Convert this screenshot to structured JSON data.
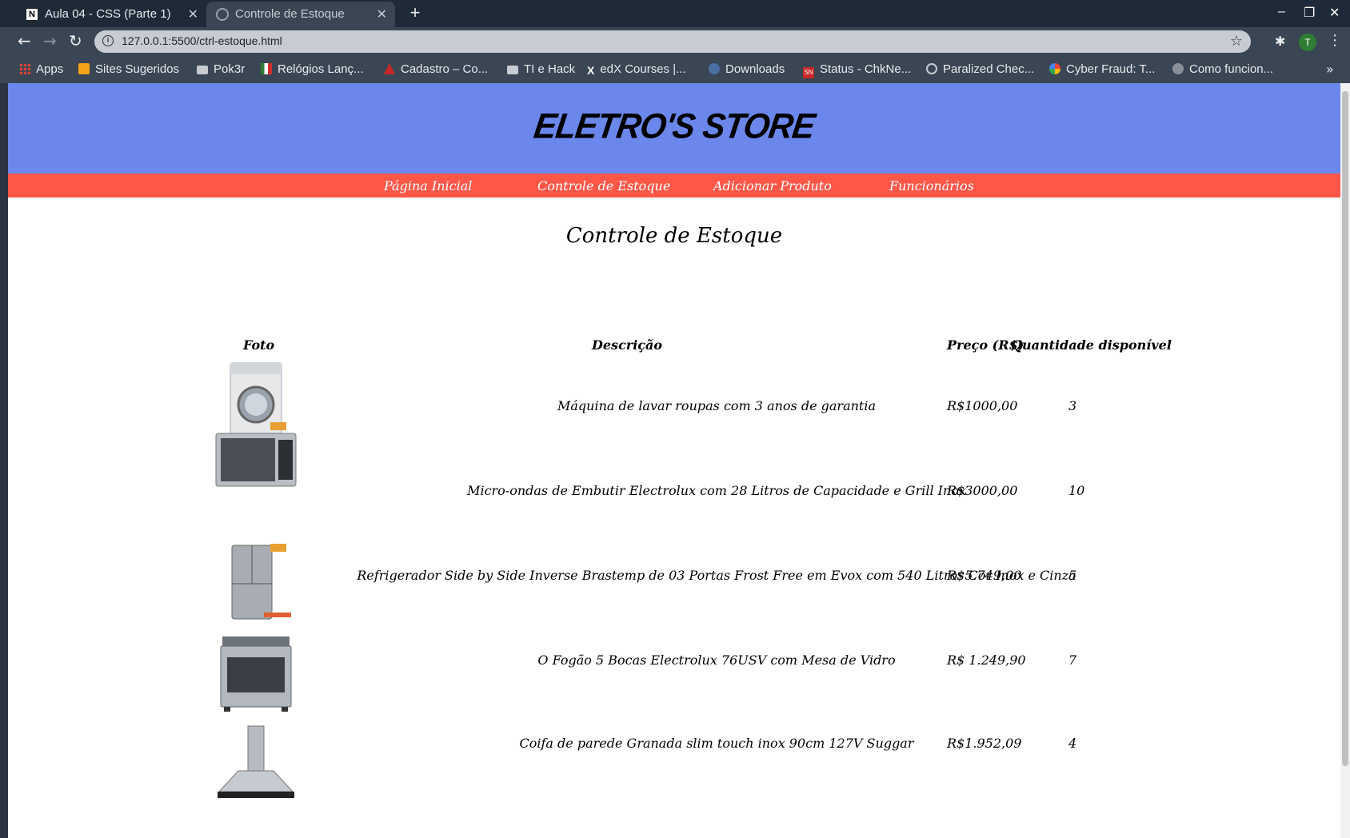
{
  "browser": {
    "tabs": [
      {
        "title": "Aula 04 - CSS (Parte 1)",
        "active": false
      },
      {
        "title": "Controle de Estoque",
        "active": true
      }
    ],
    "url": "127.0.0.1:5500/ctrl-estoque.html",
    "profile_initial": "T",
    "bookmarks": [
      {
        "label": "Apps",
        "icon": "apps-icon"
      },
      {
        "label": "Sites Sugeridos",
        "icon": "bookmark-icon"
      },
      {
        "label": "Pok3r",
        "icon": "folder-icon"
      },
      {
        "label": "Relógios Lanç...",
        "icon": "flag-italy-icon"
      },
      {
        "label": "Cadastro – Co...",
        "icon": "bookmark-red-icon"
      },
      {
        "label": "TI e Hack",
        "icon": "folder-icon"
      },
      {
        "label": "edX Courses |...",
        "icon": "x-icon"
      },
      {
        "label": "Downloads",
        "icon": "user-icon"
      },
      {
        "label": "Status - ChkNe...",
        "icon": "sn-icon"
      },
      {
        "label": "Paralized Chec...",
        "icon": "globe-icon"
      },
      {
        "label": "Cyber Fraud: T...",
        "icon": "google-icon"
      },
      {
        "label": "Como funcion...",
        "icon": "code-icon"
      }
    ]
  },
  "site": {
    "title": "Eletro's Store",
    "nav": [
      "Página Inicial",
      "Controle de Estoque",
      "Adicionar Produto",
      "Funcionários"
    ],
    "page_title": "Controle de Estoque",
    "table": {
      "headers": [
        "Foto",
        "Descrição",
        "Preço (R$)",
        "Quantidade disponível"
      ],
      "rows": [
        {
          "photo": "washing-machine",
          "description": "Máquina de lavar roupas com 3 anos de garantia",
          "price": "R$1000,00",
          "qty": "3"
        },
        {
          "photo": "microwave",
          "description": "Micro-ondas de Embutir Electrolux com 28 Litros de Capacidade e Grill Inox",
          "price": "R$3000,00",
          "qty": "10"
        },
        {
          "photo": "refrigerator",
          "description": "Refrigerador Side by Side Inverse Brastemp de 03 Portas Frost Free em Evox com 540 Litros Cor Inox e Cinza",
          "price": "R$5.749,00",
          "qty": "5"
        },
        {
          "photo": "stove",
          "description": "O Fogão 5 Bocas Electrolux 76USV com Mesa de Vidro",
          "price": "R$ 1.249,90",
          "qty": "7"
        },
        {
          "photo": "range-hood",
          "description": "Coifa de parede Granada slim touch inox 90cm 127V Suggar",
          "price": "R$1.952,09",
          "qty": "4"
        }
      ]
    }
  }
}
